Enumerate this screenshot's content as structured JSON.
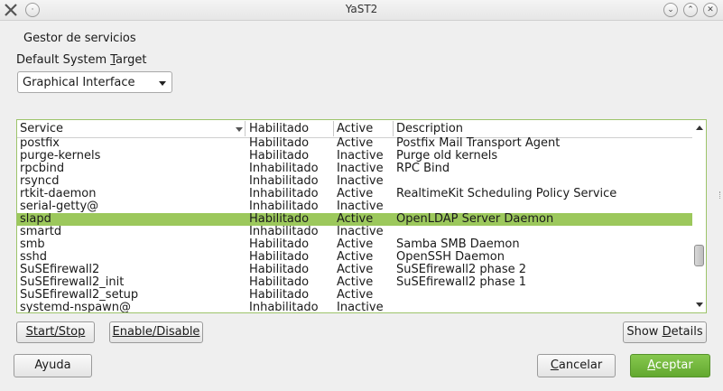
{
  "window": {
    "title": "YaST2"
  },
  "header": {
    "heading": "Gestor de servicios"
  },
  "target": {
    "label_pre": "Default System ",
    "label_accel": "T",
    "label_post": "arget",
    "selected": "Graphical Interface"
  },
  "table": {
    "columns": [
      "Service",
      "Habilitado",
      "Active",
      "Description"
    ],
    "selected_index": 6,
    "rows": [
      [
        "postfix",
        "Habilitado",
        "Active",
        "Postfix Mail Transport Agent"
      ],
      [
        "purge-kernels",
        "Habilitado",
        "Inactive",
        "Purge old kernels"
      ],
      [
        "rpcbind",
        "Inhabilitado",
        "Inactive",
        "RPC Bind"
      ],
      [
        "rsyncd",
        "Inhabilitado",
        "Inactive",
        ""
      ],
      [
        "rtkit-daemon",
        "Inhabilitado",
        "Active",
        "RealtimeKit Scheduling Policy Service"
      ],
      [
        "serial-getty@",
        "Inhabilitado",
        "Inactive",
        ""
      ],
      [
        "slapd",
        "Habilitado",
        "Active",
        "OpenLDAP Server Daemon"
      ],
      [
        "smartd",
        "Inhabilitado",
        "Inactive",
        ""
      ],
      [
        "smb",
        "Habilitado",
        "Active",
        "Samba SMB Daemon"
      ],
      [
        "sshd",
        "Habilitado",
        "Active",
        "OpenSSH Daemon"
      ],
      [
        "SuSEfirewall2",
        "Habilitado",
        "Active",
        "SuSEfirewall2 phase 2"
      ],
      [
        "SuSEfirewall2_init",
        "Habilitado",
        "Active",
        "SuSEfirewall2 phase 1"
      ],
      [
        "SuSEfirewall2_setup",
        "Habilitado",
        "Active",
        ""
      ],
      [
        "systemd-nspawn@",
        "Inhabilitado",
        "Inactive",
        ""
      ]
    ]
  },
  "buttons": {
    "start_stop": "Start/Stop",
    "enable_disable": "Enable/Disable",
    "show_details_pre": "Show ",
    "show_details_accel": "D",
    "show_details_post": "etails",
    "help": "Ayuda",
    "cancel_accel": "C",
    "cancel_post": "ancelar",
    "accept_accel": "A",
    "accept_post": "ceptar"
  },
  "colors": {
    "selection": "#9cc85c",
    "accent": "#63a830"
  }
}
